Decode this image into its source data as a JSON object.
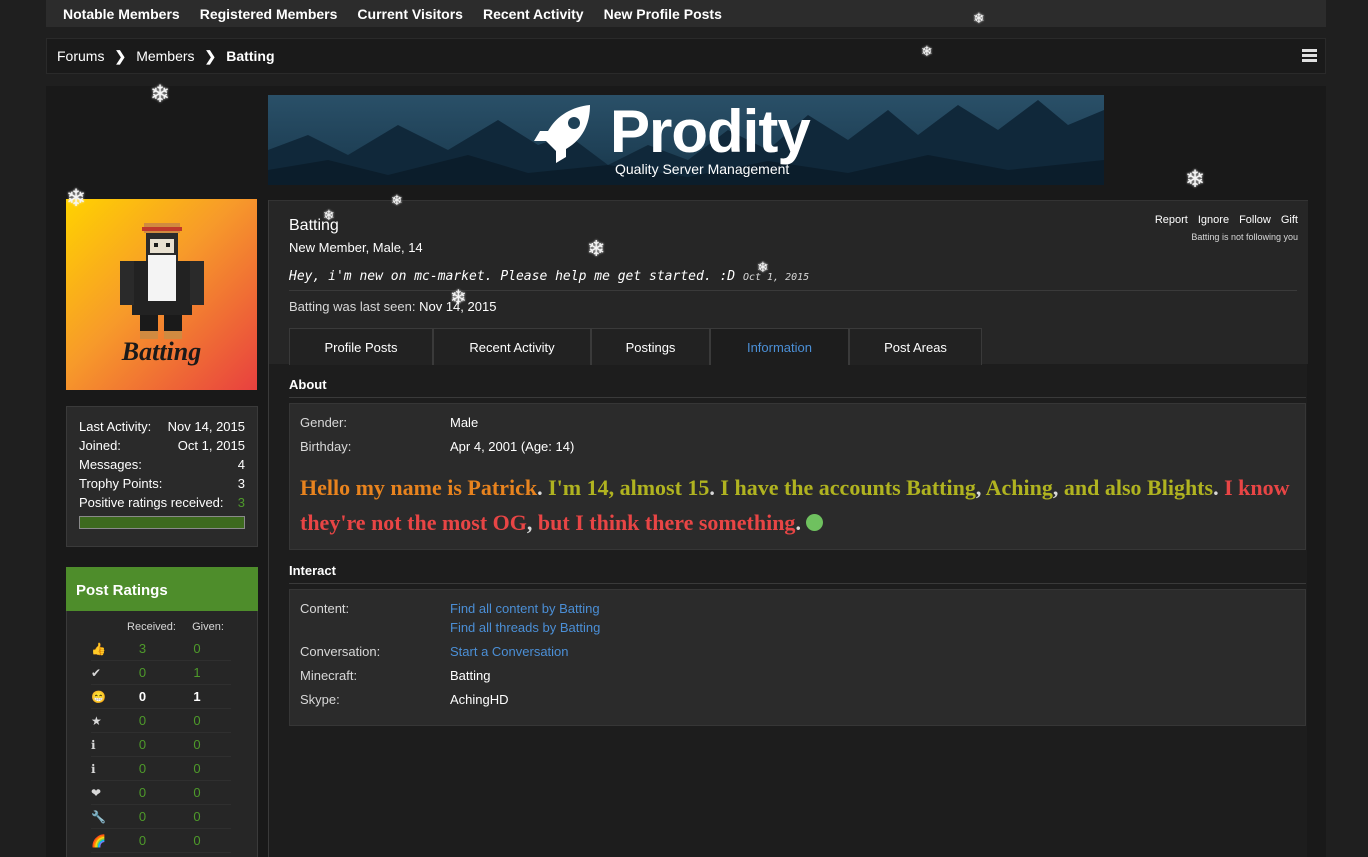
{
  "topnav": {
    "items": [
      "Notable Members",
      "Registered Members",
      "Current Visitors",
      "Recent Activity",
      "New Profile Posts"
    ]
  },
  "breadcrumb": {
    "items": [
      "Forums",
      "Members",
      "Batting"
    ]
  },
  "banner": {
    "logo_text": "Prodity",
    "logo_subtitle": "Quality Server Management"
  },
  "avatar": {
    "name": "Batting"
  },
  "stats": {
    "last_activity_label": "Last Activity:",
    "last_activity_value": "Nov 14, 2015",
    "joined_label": "Joined:",
    "joined_value": "Oct 1, 2015",
    "messages_label": "Messages:",
    "messages_value": "4",
    "trophy_label": "Trophy Points:",
    "trophy_value": "3",
    "ratings_label": "Positive ratings received:",
    "ratings_value": "3",
    "ratings_fill": 1.0
  },
  "post_ratings": {
    "title": "Post Ratings",
    "received_label": "Received:",
    "given_label": "Given:",
    "rows": [
      {
        "icon": "thumbs-up-icon",
        "glyph": "👍",
        "received": "3",
        "given": "0",
        "bold": false
      },
      {
        "icon": "checkmark-icon",
        "glyph": "✔",
        "received": "0",
        "given": "1",
        "bold": false
      },
      {
        "icon": "grin-icon",
        "glyph": "😁",
        "received": "0",
        "given": "1",
        "bold": true
      },
      {
        "icon": "star-icon",
        "glyph": "★",
        "received": "0",
        "given": "0",
        "bold": false
      },
      {
        "icon": "info-icon",
        "glyph": "ℹ",
        "received": "0",
        "given": "0",
        "bold": false
      },
      {
        "icon": "info-green-icon",
        "glyph": "ℹ",
        "received": "0",
        "given": "0",
        "bold": false
      },
      {
        "icon": "heart-icon",
        "glyph": "❤",
        "received": "0",
        "given": "0",
        "bold": false
      },
      {
        "icon": "wrench-icon",
        "glyph": "🔧",
        "received": "0",
        "given": "0",
        "bold": false
      },
      {
        "icon": "rainbow-icon",
        "glyph": "🌈",
        "received": "0",
        "given": "0",
        "bold": false
      }
    ]
  },
  "profile": {
    "username": "Batting",
    "user_title": "New Member, Male, 14",
    "status_text": "Hey, i'm new on mc-market. Please help me get started. :D",
    "status_date": "Oct 1, 2015",
    "last_seen_label": "Batting was last seen:",
    "last_seen_value": "Nov 14, 2015",
    "actions": [
      "Report",
      "Ignore",
      "Follow",
      "Gift"
    ],
    "follow_note": "Batting is not following you"
  },
  "tabs": [
    "Profile Posts",
    "Recent Activity",
    "Postings",
    "Information",
    "Post Areas"
  ],
  "active_tab": "Information",
  "about": {
    "title": "About",
    "gender_label": "Gender:",
    "gender_value": "Male",
    "birthday_label": "Birthday:",
    "birthday_value": "Apr 4, 2001 (Age: 14)",
    "bio_parts": [
      "Hello my name is Patrick",
      ". ",
      "I'm 14, almost 15",
      ". ",
      "I have the accounts Batting",
      ", ",
      "Aching",
      ", ",
      "and also Blights",
      ". ",
      "I know they're not the most OG",
      ", ",
      "but I think there something",
      ". "
    ]
  },
  "interact": {
    "title": "Interact",
    "content_label": "Content:",
    "content_link1": "Find all content by Batting",
    "content_link2": "Find all threads by Batting",
    "conversation_label": "Conversation:",
    "conversation_link": "Start a Conversation",
    "minecraft_label": "Minecraft:",
    "minecraft_value": "Batting",
    "skype_label": "Skype:",
    "skype_value": "AchingHD"
  },
  "colors": {
    "accent_green": "#4e8d2b",
    "link_blue": "#4b8fd6",
    "bio_orange": "#e8831e",
    "bio_olive": "#b0b320",
    "bio_red": "#e84545"
  }
}
